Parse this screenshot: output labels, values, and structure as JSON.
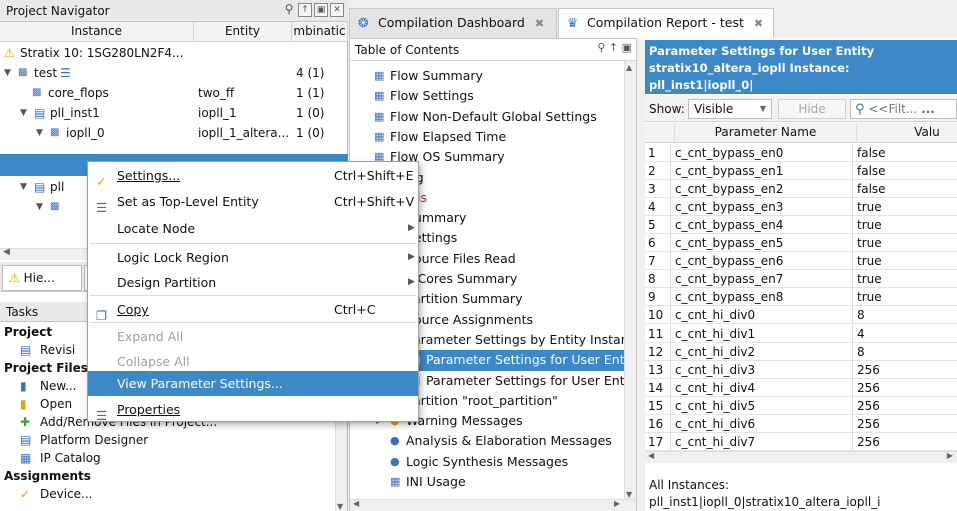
{
  "navigator": {
    "title": "Project Navigator",
    "columns": [
      "Instance",
      "Entity",
      "mbinatic"
    ],
    "rows": [
      {
        "instance": "Stratix 10: 1SG280LN2F4...",
        "entity": "",
        "comb": ""
      },
      {
        "instance": "test",
        "entity": "",
        "comb": "4 (1)"
      },
      {
        "instance": "core_flops",
        "entity": "two_ff",
        "comb": "1 (1)"
      },
      {
        "instance": "pll_inst1",
        "entity": "iopll_1",
        "comb": "1 (0)"
      },
      {
        "instance": "iopll_0",
        "entity": "iopll_1_altera...",
        "comb": "1 (0)"
      },
      {
        "instance": "",
        "entity": "",
        "comb": ""
      },
      {
        "instance": "pll",
        "entity": "",
        "comb": ""
      }
    ],
    "hier_tab": "Hie..."
  },
  "tasks": {
    "title": "Tasks",
    "sections": [
      {
        "type": "header",
        "label": "Project"
      },
      {
        "type": "item",
        "label": "Revisi"
      },
      {
        "type": "header",
        "label": "Project Files"
      },
      {
        "type": "item",
        "label": "New..."
      },
      {
        "type": "item",
        "label": "Open"
      },
      {
        "type": "item",
        "label": "Add/Remove Files in Project..."
      },
      {
        "type": "item",
        "label": "Platform Designer"
      },
      {
        "type": "item",
        "label": "IP Catalog"
      },
      {
        "type": "header",
        "label": "Assignments"
      },
      {
        "type": "item",
        "label": "Device..."
      }
    ]
  },
  "context_menu": {
    "settings": {
      "label": "Settings...",
      "shortcut": "Ctrl+Shift+E"
    },
    "set_top": {
      "label": "Set as Top-Level Entity",
      "shortcut": "Ctrl+Shift+V"
    },
    "locate_node": {
      "label": "Locate Node"
    },
    "logic_lock": {
      "label": "Logic Lock Region"
    },
    "design_partition": {
      "label": "Design Partition"
    },
    "copy": {
      "label": "Copy",
      "shortcut": "Ctrl+C"
    },
    "expand_all": {
      "label": "Expand All"
    },
    "collapse_all": {
      "label": "Collapse All"
    },
    "view_params": {
      "label": "View Parameter Settings..."
    },
    "properties": {
      "label": "Properties"
    }
  },
  "tabs": {
    "dashboard": "Compilation Dashboard",
    "report": "Compilation Report - test"
  },
  "toc": {
    "title": "Table of Contents",
    "items": [
      {
        "label": "Flow Summary",
        "indent": 0
      },
      {
        "label": "Flow Settings",
        "indent": 0
      },
      {
        "label": "Flow Non-Default Global Settings",
        "indent": 0
      },
      {
        "label": "Flow Elapsed Time",
        "indent": 0
      },
      {
        "label": "Flow OS Summary",
        "indent": 0
      },
      {
        "label": "v Log",
        "indent": 0
      },
      {
        "label": "thesis",
        "indent": 0,
        "red": true
      },
      {
        "label": "Summary",
        "indent": 1
      },
      {
        "label": "Settings",
        "indent": 1
      },
      {
        "label": "Source Files Read",
        "indent": 1
      },
      {
        "label": "P Cores Summary",
        "indent": 1
      },
      {
        "label": "Partition Summary",
        "indent": 1
      },
      {
        "label": "Source Assignments",
        "indent": 1
      },
      {
        "label": "Parameter Settings by Entity Instance",
        "indent": 1
      },
      {
        "label": "Parameter Settings for User Entity",
        "indent": 2,
        "selected": true
      },
      {
        "label": "Parameter Settings for User Entity",
        "indent": 2
      },
      {
        "label": "Partition \"root_partition\"",
        "indent": 1
      },
      {
        "label": "Warning Messages",
        "indent": 1
      },
      {
        "label": "Analysis & Elaboration Messages",
        "indent": 1
      },
      {
        "label": "Logic Synthesis Messages",
        "indent": 1
      },
      {
        "label": "INI Usage",
        "indent": 1
      }
    ]
  },
  "params": {
    "title_lines": [
      "Parameter Settings for User Entity",
      "stratix10_altera_iopll Instance: pll_inst1|iopll_0|",
      "stratix10_altera_iopll_i"
    ],
    "show_label": "Show:",
    "show_value": "Visible",
    "hide_label": "Hide",
    "filter_placeholder": "<<Filt...",
    "col_name": "Parameter Name",
    "col_value": "Valu",
    "rows": [
      [
        "1",
        "c_cnt_bypass_en0",
        "false"
      ],
      [
        "2",
        "c_cnt_bypass_en1",
        "false"
      ],
      [
        "3",
        "c_cnt_bypass_en2",
        "false"
      ],
      [
        "4",
        "c_cnt_bypass_en3",
        "true"
      ],
      [
        "5",
        "c_cnt_bypass_en4",
        "true"
      ],
      [
        "6",
        "c_cnt_bypass_en5",
        "true"
      ],
      [
        "7",
        "c_cnt_bypass_en6",
        "true"
      ],
      [
        "8",
        "c_cnt_bypass_en7",
        "true"
      ],
      [
        "9",
        "c_cnt_bypass_en8",
        "true"
      ],
      [
        "10",
        "c_cnt_hi_div0",
        "8"
      ],
      [
        "11",
        "c_cnt_hi_div1",
        "4"
      ],
      [
        "12",
        "c_cnt_hi_div2",
        "8"
      ],
      [
        "13",
        "c_cnt_hi_div3",
        "256"
      ],
      [
        "14",
        "c_cnt_hi_div4",
        "256"
      ],
      [
        "15",
        "c_cnt_hi_div5",
        "256"
      ],
      [
        "16",
        "c_cnt_hi_div6",
        "256"
      ],
      [
        "17",
        "c_cnt_hi_div7",
        "256"
      ]
    ],
    "footer_label": "All Instances:",
    "footer_value": "pll_inst1|iopll_0|stratix10_altera_iopll_i"
  }
}
